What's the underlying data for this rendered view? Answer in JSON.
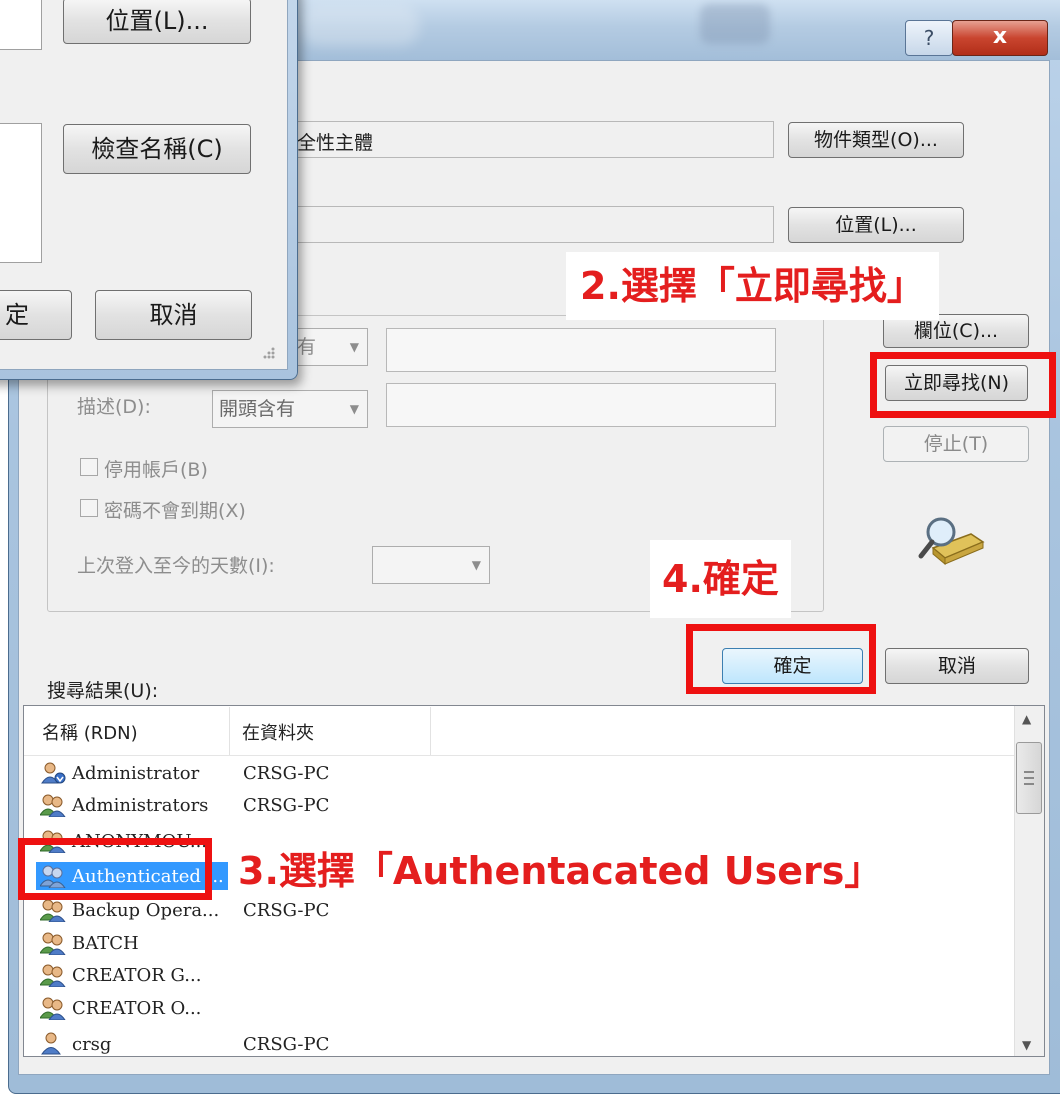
{
  "window": {
    "help_glyph": "?",
    "close_glyph": "x"
  },
  "top_section": {
    "object_type_value": "全性主體",
    "object_type_button": "物件類型(O)...",
    "location_button": "位置(L)..."
  },
  "query": {
    "partial_combo": "有",
    "description_label": "描述(D):",
    "description_combo": "開頭含有",
    "disabled_accounts": "停用帳戶(B)",
    "non_expiring_pw": "密碼不會到期(X)",
    "days_since_login": "上次登入至今的天數(I):",
    "column_button_partial": "欄位(C)...",
    "find_now_button": "立即尋找(N)",
    "stop_button": "停止(T)",
    "search_icon": "search-magnifier-icon"
  },
  "buttons": {
    "ok": "確定",
    "cancel": "取消"
  },
  "results": {
    "label": "搜尋結果(U):",
    "columns": [
      "名稱 (RDN)",
      "在資料夾"
    ],
    "rows": [
      {
        "name": "Administrator",
        "folder": "CRSG-PC",
        "icon": "user-icon"
      },
      {
        "name": "Administrators",
        "folder": "CRSG-PC",
        "icon": "group-icon"
      },
      {
        "name": "ANONYMOU...",
        "folder": "",
        "icon": "group-icon"
      },
      {
        "name": "Authenticated ...",
        "folder": "",
        "icon": "group-icon"
      },
      {
        "name": "Backup Opera...",
        "folder": "CRSG-PC",
        "icon": "group-icon"
      },
      {
        "name": "BATCH",
        "folder": "",
        "icon": "group-icon"
      },
      {
        "name": "CREATOR G...",
        "folder": "",
        "icon": "group-icon"
      },
      {
        "name": "CREATOR O...",
        "folder": "",
        "icon": "group-icon"
      },
      {
        "name": "crsg",
        "folder": "CRSG-PC",
        "icon": "user-icon"
      }
    ]
  },
  "front_dialog": {
    "location_button": "位置(L)...",
    "check_names_button": "檢查名稱(C)",
    "ok_partial": "定",
    "cancel_button": "取消"
  },
  "annotations": {
    "step2": "2.選擇「立即尋找」",
    "step3": "3.選擇「Authentacated Users」",
    "step4": "4.確定"
  },
  "colors": {
    "annotation_red": "#ee1111",
    "selection_blue": "#3399ff",
    "window_frame": "#a9c4df"
  }
}
